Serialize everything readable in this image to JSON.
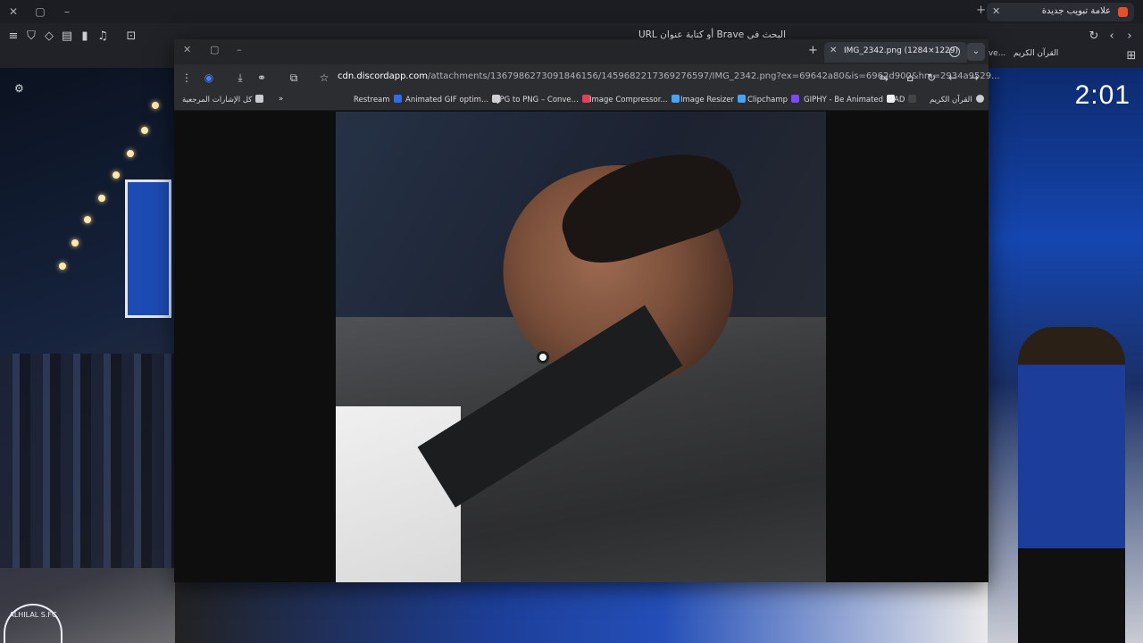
{
  "background_browser": {
    "active_tab_title": "علامة تبويب جديدة",
    "omnibox_placeholder": "البحث في Brave أو كتابة عنوان URL",
    "bookmarks": [
      "PNG – Conve...",
      "القرآن الكريم"
    ]
  },
  "background_video": {
    "clock": "2:01",
    "crest_text": "ALHILAL S.FC"
  },
  "popup": {
    "tab_title": "IMG_2342.png (1284×1229)",
    "url_host": "cdn.discordapp.com",
    "url_path": "/attachments/1367986273091846156/1459682217369276597/IMG_2342.png?ex=69642a80&is=6962d900&hm=2934a9529...",
    "bookmarks": [
      {
        "label": "كل الإشارات المرجعية",
        "color": "#c9ccd1"
      },
      {
        "label": "Restream",
        "color": "#2f6bf0"
      },
      {
        "label": "Animated GIF optim...",
        "color": "#cfcfcf"
      },
      {
        "label": "JPG to PNG – Conve...",
        "color": "#e0405a"
      },
      {
        "label": "Image Compressor...",
        "color": "#4aa3f0"
      },
      {
        "label": "Image Resizer",
        "color": "#4aa3f0"
      },
      {
        "label": "Clipchamp",
        "color": "#7a4cf0"
      },
      {
        "label": "GIPHY - Be Animated",
        "color": "#f0f0f0"
      },
      {
        "label": "AD",
        "color": "#222222"
      },
      {
        "label": "القرآن الكريم",
        "color": "#c9ccd1"
      }
    ]
  },
  "colors": {
    "accent": "#2f6bf0",
    "brave_orange": "#e5502b"
  }
}
